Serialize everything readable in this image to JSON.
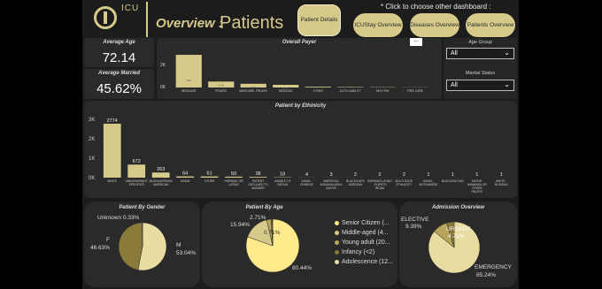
{
  "header": {
    "logo_text": "ICU",
    "title_prefix": "Overview :",
    "title_main": "Patients",
    "hint": "* Click to choose other dashboard :",
    "buttons": {
      "patient_details": "Patient Details",
      "icustay": "ICUStay Overview",
      "diseases": "Diseases Overview",
      "patients": "Patients Overview"
    },
    "more_label": "..."
  },
  "kpis": {
    "avg_age_label": "Average Age",
    "avg_age_value": "72.14",
    "avg_married_label": "Average Married",
    "avg_married_value": "45.62%"
  },
  "filters": {
    "age_group_label": "Age Group",
    "age_group_value": "All",
    "marital_label": "Marital Status",
    "marital_value": "All"
  },
  "payer": {
    "title": "Overall Payer",
    "y_ticks": [
      "2K",
      "0K"
    ],
    "bar_color": "#d6c98a"
  },
  "ethnicity": {
    "title": "Patient by Ethinicity",
    "y_ticks": [
      "3K",
      "2K",
      "1K",
      "0K"
    ]
  },
  "gender": {
    "title": "Patient By Gender",
    "labels": [
      "Unknown 0.33%",
      "F",
      "46.63%",
      "M",
      "53.04%"
    ]
  },
  "age": {
    "title": "Patient By Age",
    "labels": [
      "2.71%",
      "15.94%",
      "0.71%",
      "80.44%"
    ],
    "legend": [
      "Senior Citizen (...",
      "Middle-aged (4...",
      "Young adult (20...",
      "Infancy (<2)",
      "Adolescence (12..."
    ],
    "legend_colors": [
      "#ffe98a",
      "#d6c98a",
      "#b6a55a",
      "#8a7a3a",
      "#e8e0b0"
    ]
  },
  "admission": {
    "title": "Admission Overview",
    "labels": [
      "ELECTIVE",
      "9.39%",
      "URGENT",
      "4.72%",
      "EMERGENCY",
      "85.24%"
    ]
  },
  "chart_data": [
    {
      "type": "bar",
      "title": "Overall Payer",
      "categories": [
        "MEDICARE",
        "PRIVATE",
        "MEDICARE, PRIVATE",
        "MEDICAID",
        "OTHER",
        "AUTO LIABILITY",
        "SELF-PAY",
        "FREE CARE"
      ],
      "value_labels": [
        "4.5K",
        "0.7K",
        "0.4K",
        "0.3K",
        "",
        "",
        "",
        ""
      ],
      "values": [
        2200,
        400,
        250,
        180,
        50,
        30,
        20,
        10
      ],
      "ylim": [
        0,
        2500
      ]
    },
    {
      "type": "bar",
      "title": "Patient by Ethinicity",
      "categories": [
        "WHITE",
        "UNKNOWN/NOT SPECIFIED",
        "BLACK/AFRICAN AMERICAN",
        "ASIAN",
        "OTHER",
        "HISPANIC OR LATINO",
        "PATIENT DECLINED TO ANSWER",
        "UNABLE TO OBTAIN",
        "ASIAN - CHINESE",
        "AMERICAN INDIAN/ALASKA NATIVE",
        "BLACK/CAPE VERDEAN",
        "HISPANIC/LATINO - PUERTO RICAN",
        "MULTI RACE ETHNICITY",
        "ASIAN - VIETNAMESE",
        "BLACK/HAITIAN",
        "NATIVE HAWAIIAN OR OTHER PACIFIC ISLAND",
        "WHITE - RUSSIAN"
      ],
      "values": [
        2774,
        672,
        263,
        64,
        61,
        50,
        38,
        18,
        4,
        3,
        2,
        2,
        2,
        1,
        1,
        1,
        1
      ],
      "ylim": [
        0,
        3000
      ]
    },
    {
      "type": "pie",
      "title": "Patient By Gender",
      "categories": [
        "M",
        "F",
        "Unknown"
      ],
      "values": [
        53.04,
        46.63,
        0.33
      ]
    },
    {
      "type": "pie",
      "title": "Patient By Age",
      "categories": [
        "Senior Citizen",
        "Middle-aged",
        "Young adult",
        "Infancy",
        "Adolescence"
      ],
      "values": [
        80.44,
        15.94,
        2.71,
        0.71,
        0.2
      ]
    },
    {
      "type": "pie",
      "title": "Admission Overview",
      "categories": [
        "EMERGENCY",
        "ELECTIVE",
        "URGENT"
      ],
      "values": [
        85.24,
        9.39,
        4.72
      ]
    }
  ]
}
